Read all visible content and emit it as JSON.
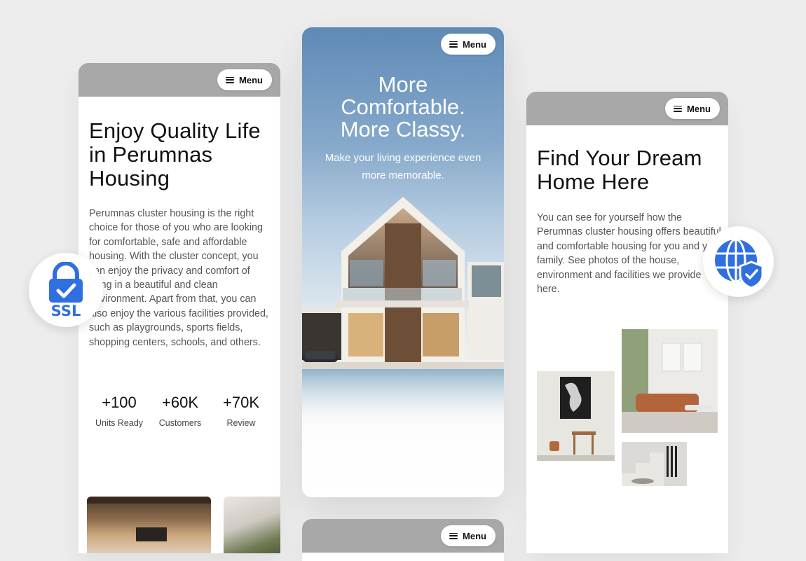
{
  "menu_label": "Menu",
  "left_screen": {
    "title": "Enjoy Quality Life in Perumnas Housing",
    "description": "Perumnas cluster housing is the right choice for those of you who are looking for comfortable, safe and affordable housing. With the cluster concept, you can enjoy the privacy and comfort of living in a beautiful and clean environment. Apart from that, you can also enjoy the various facilities provided, such as playgrounds, sports fields, shopping centers, schools, and others.",
    "stats": [
      {
        "value": "+100",
        "label": "Units Ready"
      },
      {
        "value": "+60K",
        "label": "Customers"
      },
      {
        "value": "+70K",
        "label": "Review"
      }
    ]
  },
  "center_screen": {
    "title_line1": "More",
    "title_line2": "Comfortable.",
    "title_line3": "More Classy.",
    "subtitle": "Make your living experience even more memorable."
  },
  "right_screen": {
    "title": "Find Your Dream Home Here",
    "description": "You can see for yourself how the Perumnas cluster housing offers beautiful and comfortable housing for you and your family. See photos of the house, environment and facilities we provide here."
  },
  "badges": {
    "ssl_text": "SSL",
    "ssl_icon": "lock-check-icon",
    "globe_icon": "globe-shield-icon",
    "accent_color": "#2f6fe0"
  }
}
